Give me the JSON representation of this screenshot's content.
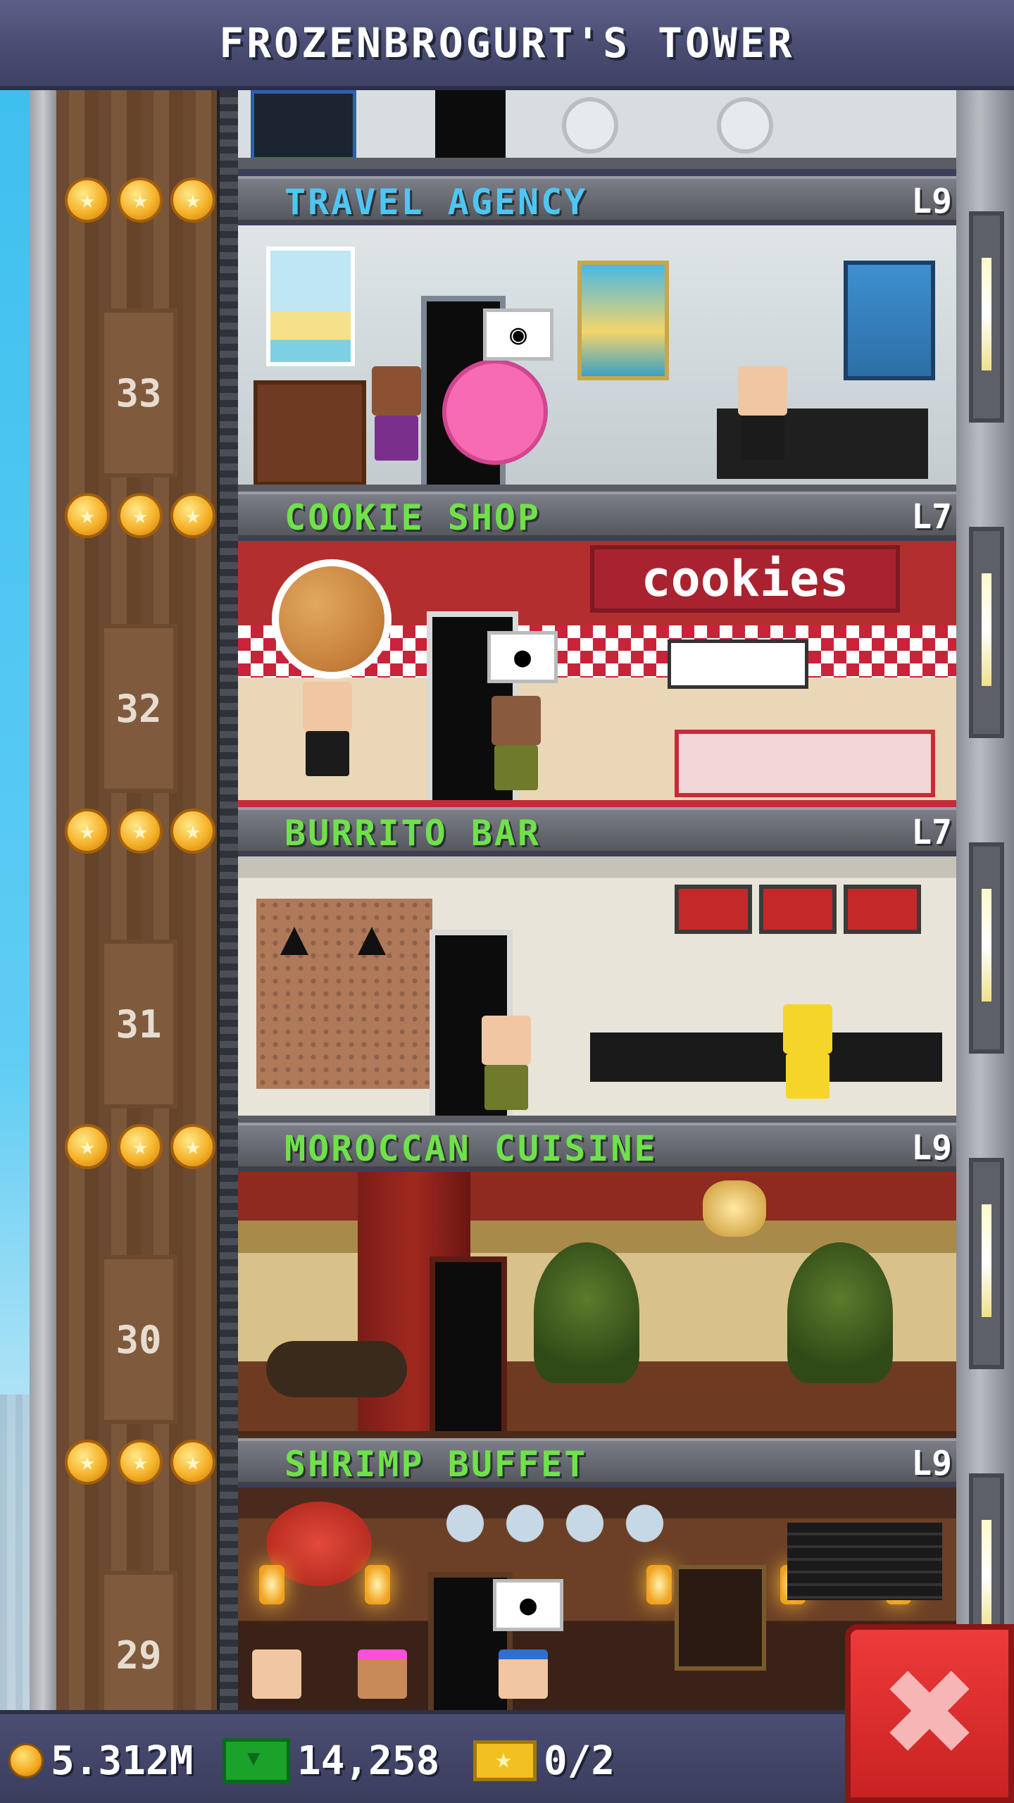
{
  "header": {
    "title": "FROZENBROGURT'S TOWER"
  },
  "floors": [
    {
      "number": "33",
      "name": "TRAVEL AGENCY",
      "level": "L9",
      "name_color": "#4fc6f2",
      "stars": 3,
      "bubble_icon": "camera-icon"
    },
    {
      "number": "32",
      "name": "COOKIE SHOP",
      "level": "L7",
      "name_color": "#6fe24a",
      "stars": 3,
      "sign": "cookies",
      "bubble_icon": "macaron-icon"
    },
    {
      "number": "31",
      "name": "BURRITO BAR",
      "level": "L7",
      "name_color": "#6fe24a",
      "stars": 3
    },
    {
      "number": "30",
      "name": "MOROCCAN CUISINE",
      "level": "L9",
      "name_color": "#6fe24a",
      "stars": 3
    },
    {
      "number": "29",
      "name": "SHRIMP BUFFET",
      "level": "L9",
      "name_color": "#6fe24a",
      "stars": 3,
      "bubble_icon": "shrimp-icon"
    }
  ],
  "bottom_bar": {
    "coins": "5.312M",
    "bux": "14,258",
    "tickets": "0/2"
  },
  "colors": {
    "header": "#474b70",
    "retail_label": "#4fc6f2",
    "food_label": "#6fe24a",
    "close_button": "#d92b2b"
  }
}
